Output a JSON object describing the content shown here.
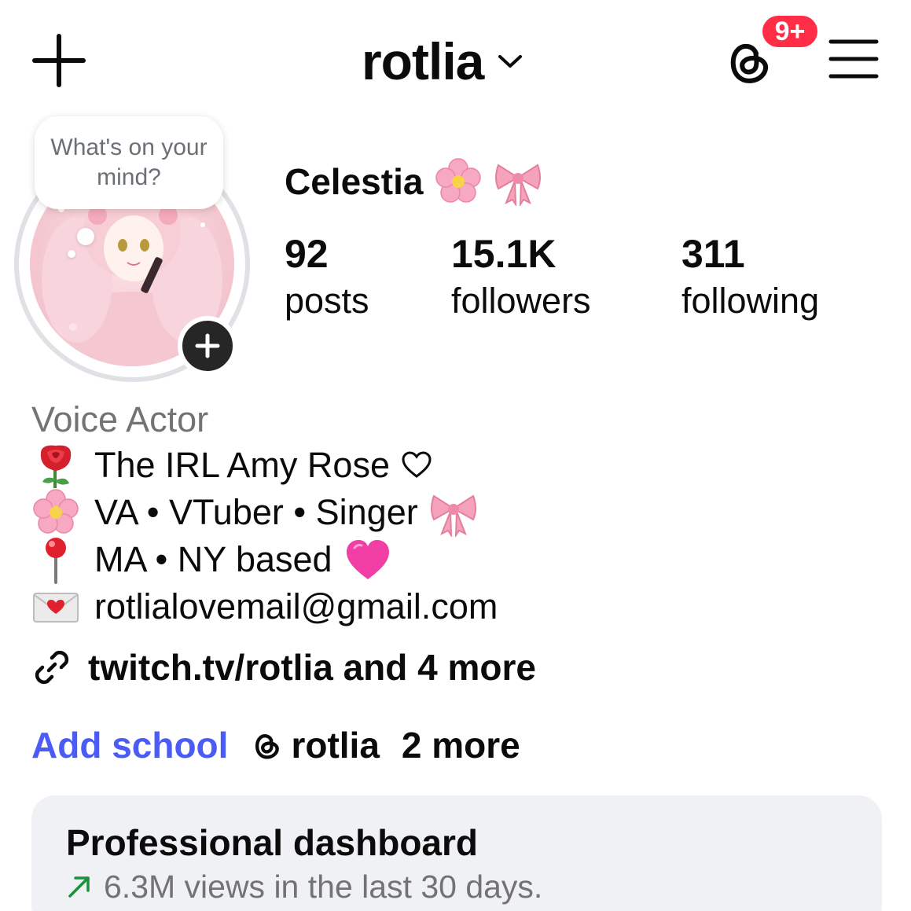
{
  "header": {
    "username": "rotlia",
    "notification_badge": "9+",
    "create_icon": "plus-icon",
    "threads_icon": "threads-icon",
    "menu_icon": "hamburger-menu-icon",
    "badge_color": "#ff2d46"
  },
  "note": {
    "text": "What's on your mind?"
  },
  "profile": {
    "display_name": "Celestia",
    "name_emojis": [
      "cherry-blossom-emoji",
      "ribbon-emoji"
    ],
    "avatar": "anime-girl-pink-avatar",
    "add_story_icon": "plus-icon"
  },
  "stats": {
    "posts": {
      "value": "92",
      "label": "posts"
    },
    "followers": {
      "value": "15.1K",
      "label": "followers"
    },
    "following": {
      "value": "311",
      "label": "following"
    }
  },
  "bio": {
    "category": "Voice Actor",
    "lines": [
      {
        "icon": "rose-emoji",
        "text": "The IRL Amy Rose",
        "tail": "white-heart-outline"
      },
      {
        "icon": "cherry-blossom-emoji",
        "text": "VA • VTuber • Singer",
        "tail": "ribbon-emoji"
      },
      {
        "icon": "round-pushpin-emoji",
        "text": "MA • NY based",
        "tail": "pink-heart-emoji"
      },
      {
        "icon": "love-letter-emoji",
        "text": "rotlialovemail@gmail.com"
      }
    ],
    "link": {
      "icon": "link-icon",
      "text": "twitch.tv/rotlia and 4 more"
    }
  },
  "chips": {
    "add_school": "Add school",
    "threads_handle": "rotlia",
    "more": "2 more",
    "add_school_color": "#4a5cf5"
  },
  "dashboard": {
    "title": "Professional dashboard",
    "subtitle": "6.3M views in the last 30 days.",
    "trend_icon": "trend-up-arrow-icon",
    "trend_color": "#1a8f3c"
  }
}
